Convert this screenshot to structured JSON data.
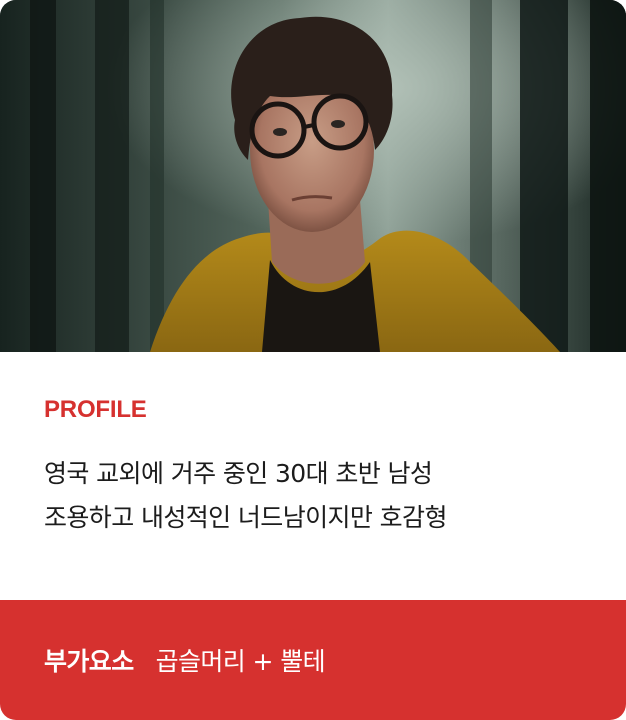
{
  "profile": {
    "label": "PROFILE",
    "lines": [
      "영국 교외에 거주 중인 30대 초반 남성",
      "조용하고 내성적인 너드남이지만 호감형"
    ]
  },
  "extra": {
    "label": "부가요소",
    "value": "곱슬머리 + 뿔테"
  },
  "colors": {
    "accent": "#d6312f",
    "text": "#1c1c1c",
    "bar_text": "#ffffff"
  }
}
